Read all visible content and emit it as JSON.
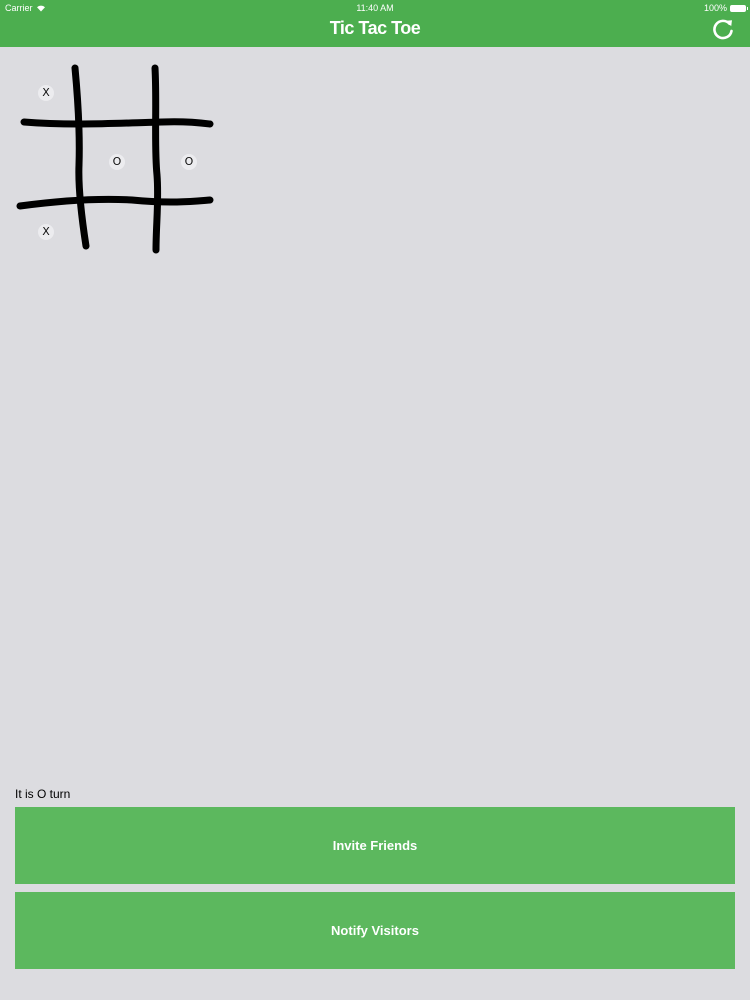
{
  "status_bar": {
    "carrier": "Carrier",
    "time": "11:40 AM",
    "battery": "100%"
  },
  "header": {
    "title": "Tic Tac Toe",
    "refresh_icon": "refresh-icon",
    "color": "#4cae4f"
  },
  "board": {
    "cells": [
      [
        "X",
        "",
        ""
      ],
      [
        "",
        "O",
        "O"
      ],
      [
        "X",
        "",
        ""
      ]
    ]
  },
  "turn_text": "It is O turn",
  "buttons": {
    "invite_label": "Invite Friends",
    "notify_label": "Notify Visitors",
    "color": "#5cb85e"
  }
}
